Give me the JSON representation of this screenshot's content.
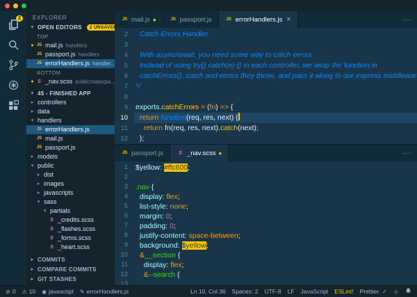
{
  "theme": {
    "accent": "#ffc600",
    "editor_background": "#193549",
    "panel_background": "#15232d",
    "comment_blue": "#0088ff",
    "keyword_orange": "#ff9d00",
    "selector_green": "#3ad900",
    "selection_highlight": "#ffc600"
  },
  "ui": {
    "more_actions": "···"
  },
  "activity_bar": {
    "badge": "2",
    "items": [
      {
        "name": "explorer",
        "active": true
      },
      {
        "name": "search",
        "active": false
      },
      {
        "name": "source-control",
        "active": false
      },
      {
        "name": "debug",
        "active": false
      },
      {
        "name": "extensions",
        "active": false
      }
    ]
  },
  "sidebar": {
    "title": "EXPLORER",
    "open_editors": {
      "label": "OPEN EDITORS",
      "badge": "2 UNSAVED",
      "groups": [
        {
          "label": "TOP",
          "items": [
            {
              "file": "mail.js",
              "desc": "handlers",
              "icon": "js",
              "dirty": true,
              "selected": false
            },
            {
              "file": "passport.js",
              "desc": "handlers",
              "icon": "js",
              "dirty": false,
              "selected": false
            },
            {
              "file": "errorHandlers.js",
              "desc": "handler...",
              "icon": "js",
              "dirty": false,
              "selected": true
            }
          ]
        },
        {
          "label": "BOTTOM",
          "items": [
            {
              "file": "_nav.scss",
              "desc": "public/sass/pa...",
              "icon": "sass",
              "dirty": true,
              "selected": false
            }
          ]
        }
      ]
    },
    "tree": {
      "label": "45 - FINISHED APP",
      "items": [
        {
          "name": "controllers",
          "type": "folder",
          "depth": 0,
          "expanded": false
        },
        {
          "name": "data",
          "type": "folder",
          "depth": 0,
          "expanded": false
        },
        {
          "name": "handlers",
          "type": "folder",
          "depth": 0,
          "expanded": true
        },
        {
          "name": "errorHandlers.js",
          "type": "js",
          "depth": 1,
          "selected": true
        },
        {
          "name": "mail.js",
          "type": "js",
          "depth": 1
        },
        {
          "name": "passport.js",
          "type": "js",
          "depth": 1
        },
        {
          "name": "models",
          "type": "folder",
          "depth": 0,
          "expanded": false
        },
        {
          "name": "public",
          "type": "folder",
          "depth": 0,
          "expanded": true
        },
        {
          "name": "dist",
          "type": "folder",
          "depth": 1,
          "expanded": false
        },
        {
          "name": "images",
          "type": "folder",
          "depth": 1,
          "expanded": false
        },
        {
          "name": "javascripts",
          "type": "folder",
          "depth": 1,
          "expanded": false
        },
        {
          "name": "sass",
          "type": "folder",
          "depth": 1,
          "expanded": true
        },
        {
          "name": "partials",
          "type": "folder",
          "depth": 2,
          "expanded": true
        },
        {
          "name": "_credits.scss",
          "type": "sass",
          "depth": 3
        },
        {
          "name": "_flashes.scss",
          "type": "sass",
          "depth": 3
        },
        {
          "name": "_forms.scss",
          "type": "sass",
          "depth": 3
        },
        {
          "name": "_heart.scss",
          "type": "sass",
          "depth": 3
        }
      ]
    },
    "sections": [
      "COMMITS",
      "COMPARE COMMITS",
      "GIT STASHES"
    ]
  },
  "editors": [
    {
      "tabs": [
        {
          "label": "mail.js",
          "icon": "js",
          "dirty": true,
          "active": false
        },
        {
          "label": "passport.js",
          "icon": "js",
          "dirty": false,
          "active": false
        },
        {
          "label": "errorHandlers.js",
          "icon": "js",
          "dirty": false,
          "active": true
        }
      ],
      "lines": [
        {
          "n": 2,
          "toks": [
            {
              "c": "cm",
              "t": "  Catch Errors Handler"
            }
          ]
        },
        {
          "n": 3,
          "toks": []
        },
        {
          "n": 4,
          "toks": [
            {
              "c": "cm",
              "t": "  With async/await, you need some way to catch errors"
            }
          ]
        },
        {
          "n": 5,
          "toks": [
            {
              "c": "cm",
              "t": "  Instead of using try{} catch(e) {} in each controller, we wrap the function in"
            }
          ]
        },
        {
          "n": 6,
          "toks": [
            {
              "c": "cm",
              "t": "  catchErrors(), catch and errors they throw, and pass it along to our express middleware with next()"
            }
          ]
        },
        {
          "n": 7,
          "toks": [
            {
              "c": "cm",
              "t": "*/"
            }
          ]
        },
        {
          "n": 8,
          "toks": []
        },
        {
          "n": 9,
          "toks": [
            {
              "c": "obj",
              "t": "exports"
            },
            {
              "c": "pn",
              "t": "."
            },
            {
              "c": "fn",
              "t": "catchErrors"
            },
            {
              "c": "pn",
              "t": " "
            },
            {
              "c": "kw",
              "t": "="
            },
            {
              "c": "pn",
              "t": " ("
            },
            {
              "c": "par",
              "t": "fn"
            },
            {
              "c": "pn",
              "t": ") "
            },
            {
              "c": "kw",
              "t": "=>"
            },
            {
              "c": "pn",
              "t": " {"
            }
          ]
        },
        {
          "n": 10,
          "active": true,
          "cursor": true,
          "toks": [
            {
              "c": "pn",
              "t": "  "
            },
            {
              "c": "kw",
              "t": "return"
            },
            {
              "c": "pn",
              "t": " "
            },
            {
              "c": "st",
              "t": "function"
            },
            {
              "c": "pn",
              "t": "(req, res, next) {"
            }
          ]
        },
        {
          "n": 11,
          "toks": [
            {
              "c": "pn",
              "t": "    "
            },
            {
              "c": "kw",
              "t": "return"
            },
            {
              "c": "pn",
              "t": " fn(req, res, next)."
            },
            {
              "c": "fn",
              "t": "catch"
            },
            {
              "c": "pn",
              "t": "(next);"
            }
          ]
        },
        {
          "n": 12,
          "toks": [
            {
              "c": "pn",
              "t": "  };"
            }
          ]
        }
      ]
    },
    {
      "tabs": [
        {
          "label": "passport.js",
          "icon": "js",
          "dirty": false,
          "active": false
        },
        {
          "label": "_nav.scss",
          "icon": "sass",
          "dirty": true,
          "active": true
        }
      ],
      "lines": [
        {
          "n": 1,
          "toks": [
            {
              "c": "var",
              "t": "$yellow"
            },
            {
              "c": "pn",
              "t": ": "
            },
            {
              "c": "hl",
              "t": "#ffc600"
            },
            {
              "c": "pn",
              "t": ";"
            }
          ]
        },
        {
          "n": 2,
          "toks": []
        },
        {
          "n": 3,
          "toks": [
            {
              "c": "sel",
              "t": ".nav"
            },
            {
              "c": "pn",
              "t": " {"
            }
          ]
        },
        {
          "n": 4,
          "toks": [
            {
              "c": "pn",
              "t": "  "
            },
            {
              "c": "pr",
              "t": "display"
            },
            {
              "c": "pn",
              "t": ": "
            },
            {
              "c": "vl",
              "t": "flex"
            },
            {
              "c": "pn",
              "t": ";"
            }
          ]
        },
        {
          "n": 5,
          "toks": [
            {
              "c": "pn",
              "t": "  "
            },
            {
              "c": "pr",
              "t": "list-style"
            },
            {
              "c": "pn",
              "t": ": "
            },
            {
              "c": "vl",
              "t": "none"
            },
            {
              "c": "pn",
              "t": ";"
            }
          ]
        },
        {
          "n": 6,
          "toks": [
            {
              "c": "pn",
              "t": "  "
            },
            {
              "c": "pr",
              "t": "margin"
            },
            {
              "c": "pn",
              "t": ": "
            },
            {
              "c": "num",
              "t": "0"
            },
            {
              "c": "pn",
              "t": ";"
            }
          ]
        },
        {
          "n": 7,
          "toks": [
            {
              "c": "pn",
              "t": "  "
            },
            {
              "c": "pr",
              "t": "padding"
            },
            {
              "c": "pn",
              "t": ": "
            },
            {
              "c": "num",
              "t": "0"
            },
            {
              "c": "pn",
              "t": ";"
            }
          ]
        },
        {
          "n": 8,
          "toks": [
            {
              "c": "pn",
              "t": "  "
            },
            {
              "c": "pr",
              "t": "justify-content"
            },
            {
              "c": "pn",
              "t": ": "
            },
            {
              "c": "vl",
              "t": "space-between"
            },
            {
              "c": "pn",
              "t": ";"
            }
          ]
        },
        {
          "n": 9,
          "toks": [
            {
              "c": "pn",
              "t": "  "
            },
            {
              "c": "pr",
              "t": "background"
            },
            {
              "c": "pn",
              "t": ": "
            },
            {
              "c": "hl",
              "t": "$yellow"
            },
            {
              "c": "pn",
              "t": ";"
            }
          ]
        },
        {
          "n": 10,
          "toks": [
            {
              "c": "pn",
              "t": "  "
            },
            {
              "c": "kw",
              "t": "&"
            },
            {
              "c": "sel",
              "t": "__section"
            },
            {
              "c": "pn",
              "t": " {"
            }
          ]
        },
        {
          "n": 11,
          "toks": [
            {
              "c": "pn",
              "t": "    "
            },
            {
              "c": "pr",
              "t": "display"
            },
            {
              "c": "pn",
              "t": ": "
            },
            {
              "c": "vl",
              "t": "flex"
            },
            {
              "c": "pn",
              "t": ";"
            }
          ]
        },
        {
          "n": 12,
          "toks": [
            {
              "c": "pn",
              "t": "    "
            },
            {
              "c": "kw",
              "t": "&"
            },
            {
              "c": "sel",
              "t": "--search"
            },
            {
              "c": "pn",
              "t": " {"
            }
          ]
        },
        {
          "n": 13,
          "toks": []
        }
      ]
    }
  ],
  "status_bar": {
    "left": [
      {
        "name": "problems-errors",
        "icon": "error",
        "text": "0"
      },
      {
        "name": "problems-warnings",
        "icon": "warning",
        "text": "10"
      },
      {
        "name": "spellcheck-language",
        "icon": "eye",
        "text": "javascript"
      },
      {
        "name": "active-file",
        "icon": "pencil",
        "text": "errorHandlers.js"
      }
    ],
    "right": [
      {
        "name": "cursor-position",
        "text": "Ln 10, Col 36"
      },
      {
        "name": "indentation",
        "text": "Spaces: 2"
      },
      {
        "name": "encoding",
        "text": "UTF-8"
      },
      {
        "name": "eol",
        "text": "LF"
      },
      {
        "name": "language-mode",
        "text": "JavaScript"
      },
      {
        "name": "eslint",
        "text": "ESLint!"
      },
      {
        "name": "prettier",
        "text": "Prettier: ✓"
      }
    ],
    "right_icons": [
      {
        "name": "feedback-smiley",
        "icon": "smiley"
      },
      {
        "name": "notifications-bell",
        "icon": "bell"
      }
    ]
  }
}
